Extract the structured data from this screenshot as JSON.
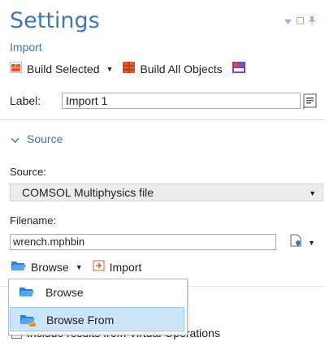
{
  "header": {
    "title": "Settings",
    "subtitle": "Import"
  },
  "toolbar": {
    "build_selected": "Build Selected",
    "build_all": "Build All Objects"
  },
  "label_row": {
    "label": "Label:",
    "value": "Import 1"
  },
  "source_section": {
    "title": "Source"
  },
  "source": {
    "label": "Source:",
    "selected": "COMSOL Multiphysics file"
  },
  "filename": {
    "label": "Filename:",
    "value": "wrench.mphbin"
  },
  "actions": {
    "browse": "Browse",
    "import": "Import"
  },
  "browse_menu": {
    "items": [
      {
        "label": "Browse"
      },
      {
        "label": "Browse From"
      }
    ]
  },
  "options": {
    "include_text": "Include results from Virtual Operations"
  }
}
